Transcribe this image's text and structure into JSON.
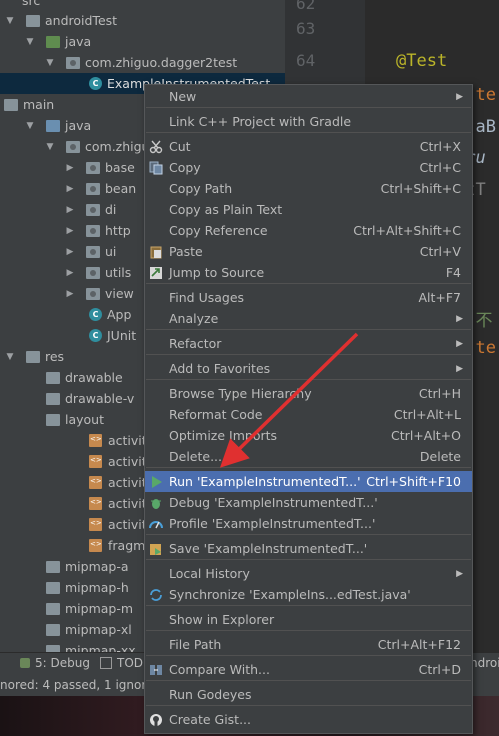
{
  "tree": {
    "top_partial": "src",
    "items": [
      {
        "label": "androidTest",
        "arrow": "▼",
        "icon": "folder"
      },
      {
        "label": "java",
        "arrow": "▼",
        "icon": "folder-green"
      },
      {
        "label": "com.zhiguo.dagger2test",
        "arrow": "▼",
        "icon": "package"
      },
      {
        "label": "ExampleInstrumentedTest",
        "arrow": "",
        "icon": "class"
      },
      {
        "label": "main",
        "arrow": "▼",
        "icon": "folder"
      },
      {
        "label": "java",
        "arrow": "▼",
        "icon": "folder-blue"
      },
      {
        "label": "com.zhiguo.",
        "arrow": "▼",
        "icon": "package"
      },
      {
        "label": "base",
        "arrow": "▶",
        "icon": "package"
      },
      {
        "label": "bean",
        "arrow": "▶",
        "icon": "package"
      },
      {
        "label": "di",
        "arrow": "▶",
        "icon": "package"
      },
      {
        "label": "http",
        "arrow": "▶",
        "icon": "package"
      },
      {
        "label": "ui",
        "arrow": "▶",
        "icon": "package"
      },
      {
        "label": "utils",
        "arrow": "▶",
        "icon": "package"
      },
      {
        "label": "view",
        "arrow": "▶",
        "icon": "package"
      },
      {
        "label": "App",
        "arrow": "",
        "icon": "class"
      },
      {
        "label": "JUnit",
        "arrow": "",
        "icon": "class"
      },
      {
        "label": "res",
        "arrow": "▼",
        "icon": "folder"
      },
      {
        "label": "drawable",
        "arrow": "▶",
        "icon": "folder"
      },
      {
        "label": "drawable-v",
        "arrow": "▶",
        "icon": "folder"
      },
      {
        "label": "layout",
        "arrow": "▼",
        "icon": "folder"
      },
      {
        "label": "activity_",
        "arrow": "",
        "icon": "xml"
      },
      {
        "label": "activity_",
        "arrow": "",
        "icon": "xml"
      },
      {
        "label": "activity_",
        "arrow": "",
        "icon": "xml"
      },
      {
        "label": "activity_",
        "arrow": "",
        "icon": "xml"
      },
      {
        "label": "activity_",
        "arrow": "",
        "icon": "xml"
      },
      {
        "label": "fragme",
        "arrow": "",
        "icon": "xml"
      },
      {
        "label": "mipmap-a",
        "arrow": "▶",
        "icon": "folder"
      },
      {
        "label": "mipmap-h",
        "arrow": "▶",
        "icon": "folder"
      },
      {
        "label": "mipmap-m",
        "arrow": "▶",
        "icon": "folder"
      },
      {
        "label": "mipmap-xl",
        "arrow": "▶",
        "icon": "folder"
      },
      {
        "label": "mipmap-xx",
        "arrow": "▶",
        "icon": "folder"
      }
    ]
  },
  "editor": {
    "line_numbers": [
      "62",
      "63",
      "64"
    ],
    "annotation": "@Test",
    "code_fragments": [
      "d te",
      "n aB",
      "Tru",
      "rtT",
      "(\"不",
      "d te"
    ]
  },
  "bottom_bar": {
    "debug_tab": "5: Debug",
    "todo_tab": "TOD",
    "right_tab": "ndroi"
  },
  "status_bar": {
    "text": "nored: 4 passed, 1 ignore"
  },
  "menu": {
    "items": [
      {
        "label": "New",
        "shortcut": "",
        "submenu": true,
        "icon": ""
      },
      {
        "label": "Link C++ Project with Gradle",
        "shortcut": "",
        "icon": ""
      },
      {
        "label": "Cut",
        "shortcut": "Ctrl+X",
        "icon": "scissors-icon"
      },
      {
        "label": "Copy",
        "shortcut": "Ctrl+C",
        "icon": "copy-icon"
      },
      {
        "label": "Copy Path",
        "shortcut": "Ctrl+Shift+C",
        "icon": ""
      },
      {
        "label": "Copy as Plain Text",
        "shortcut": "",
        "icon": ""
      },
      {
        "label": "Copy Reference",
        "shortcut": "Ctrl+Alt+Shift+C",
        "icon": ""
      },
      {
        "label": "Paste",
        "shortcut": "Ctrl+V",
        "icon": "paste-icon"
      },
      {
        "label": "Jump to Source",
        "shortcut": "F4",
        "icon": "jump-icon"
      },
      {
        "label": "Find Usages",
        "shortcut": "Alt+F7",
        "icon": ""
      },
      {
        "label": "Analyze",
        "shortcut": "",
        "submenu": true,
        "icon": ""
      },
      {
        "label": "Refactor",
        "shortcut": "",
        "submenu": true,
        "icon": ""
      },
      {
        "label": "Add to Favorites",
        "shortcut": "",
        "submenu": true,
        "icon": ""
      },
      {
        "label": "Browse Type Hierarchy",
        "shortcut": "Ctrl+H",
        "icon": ""
      },
      {
        "label": "Reformat Code",
        "shortcut": "Ctrl+Alt+L",
        "icon": ""
      },
      {
        "label": "Optimize Imports",
        "shortcut": "Ctrl+Alt+O",
        "icon": ""
      },
      {
        "label": "Delete...",
        "shortcut": "Delete",
        "icon": ""
      },
      {
        "label": "Run 'ExampleInstrumentedT...'",
        "shortcut": "Ctrl+Shift+F10",
        "icon": "run-icon",
        "highlighted": true
      },
      {
        "label": "Debug 'ExampleInstrumentedT...'",
        "shortcut": "",
        "icon": "debug-icon"
      },
      {
        "label": "Profile 'ExampleInstrumentedT...'",
        "shortcut": "",
        "icon": "profile-icon"
      },
      {
        "label": "Save 'ExampleInstrumentedT...'",
        "shortcut": "",
        "icon": "save-config-icon"
      },
      {
        "label": "Local History",
        "shortcut": "",
        "submenu": true,
        "icon": ""
      },
      {
        "label": "Synchronize 'ExampleIns...edTest.java'",
        "shortcut": "",
        "icon": "sync-icon"
      },
      {
        "label": "Show in Explorer",
        "shortcut": "",
        "icon": ""
      },
      {
        "label": "File Path",
        "shortcut": "Ctrl+Alt+F12",
        "icon": ""
      },
      {
        "label": "Compare With...",
        "shortcut": "Ctrl+D",
        "icon": "compare-icon"
      },
      {
        "label": "Run Godeyes",
        "shortcut": "",
        "icon": ""
      },
      {
        "label": "Create Gist...",
        "shortcut": "",
        "icon": "github-icon"
      }
    ]
  },
  "colors": {
    "menu_highlight": "#4b6eaf",
    "arrow_annotation": "#e03030",
    "annotation_color": "#bbb529"
  }
}
